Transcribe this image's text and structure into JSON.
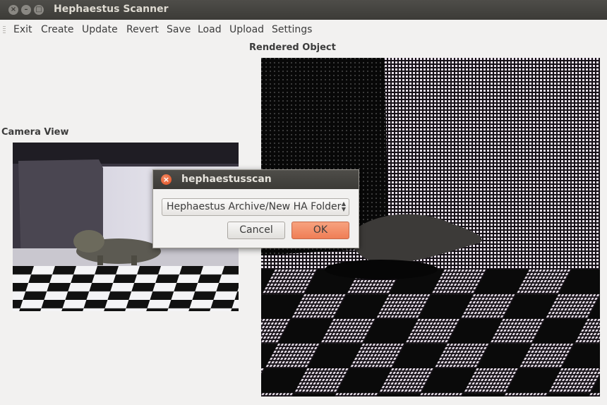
{
  "window": {
    "title": "Hephaestus Scanner"
  },
  "menu": {
    "items": [
      "Exit",
      "Create",
      "Update",
      "Revert",
      "Save",
      "Load",
      "Upload",
      "Settings"
    ]
  },
  "camera_panel": {
    "label": "Camera View"
  },
  "render_panel": {
    "label": "Rendered Object"
  },
  "dialog": {
    "title": "hephaestusscan",
    "folder_select_value": "Hephaestus Archive/New HA Folder",
    "cancel_label": "Cancel",
    "ok_label": "OK"
  },
  "colors": {
    "accent_ok": "#ef7e56",
    "close_button": "#de4d1f",
    "titlebar": "#3c3b37"
  },
  "icons": {
    "close": "close-icon",
    "minimize": "minimize-icon",
    "maximize": "maximize-icon",
    "combo": "up-down-arrows-icon"
  }
}
